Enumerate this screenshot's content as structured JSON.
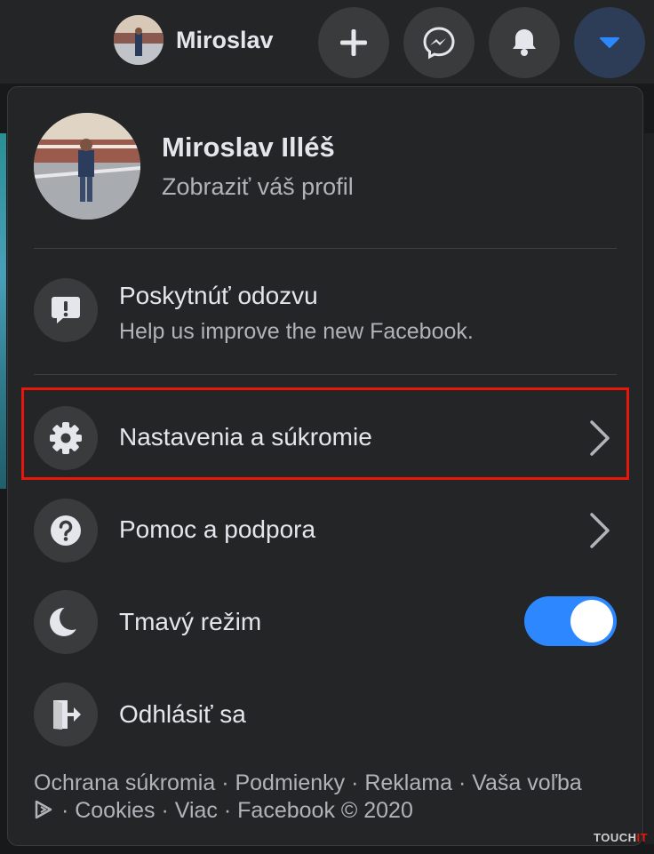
{
  "header": {
    "user_name": "Miroslav",
    "icons": [
      "plus-icon",
      "messenger-icon",
      "bell-icon",
      "caret-down-icon"
    ]
  },
  "profile": {
    "name": "Miroslav Illéš",
    "subtitle": "Zobraziť váš profil"
  },
  "feedback": {
    "label": "Poskytnúť odozvu",
    "sublabel": "Help us improve the new Facebook."
  },
  "menu_items": [
    {
      "label": "Nastavenia a súkromie",
      "icon": "gear-icon",
      "has_chevron": true,
      "highlighted": true
    },
    {
      "label": "Pomoc a podpora",
      "icon": "question-icon",
      "has_chevron": true
    },
    {
      "label": "Tmavý režim",
      "icon": "moon-icon",
      "toggle": true,
      "toggle_on": true
    },
    {
      "label": "Odhlásiť sa",
      "icon": "logout-icon"
    }
  ],
  "footer": {
    "line1": "Ochrana súkromia · Podmienky · Reklama · Vaša voľba",
    "line2": " · Cookies · Viac · Facebook © 2020"
  },
  "watermark": {
    "part1": "TOUCH",
    "part2": "IT"
  },
  "colors": {
    "background": "#18191a",
    "panel": "#242526",
    "icon_bg": "#3a3b3c",
    "accent": "#2d88ff",
    "highlight_border": "#e8170c"
  }
}
